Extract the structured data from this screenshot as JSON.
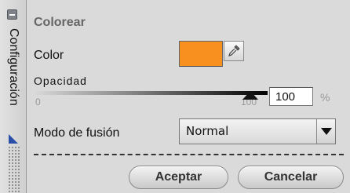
{
  "sidebar": {
    "tab_label": "Configuración"
  },
  "panel": {
    "title": "Colorear",
    "color_label": "Color",
    "color_value": "#f7901e",
    "opacity_label": "Opacidad",
    "opacity_min": "0",
    "opacity_max": "100",
    "opacity_value": "100",
    "opacity_unit": "%",
    "blend_label": "Modo de fusión",
    "blend_value": "Normal"
  },
  "buttons": {
    "accept": "Aceptar",
    "cancel": "Cancelar"
  },
  "icons": [
    "collapse-icon",
    "eyedropper-icon",
    "resize-corner-icon",
    "dropdown-arrow-icon",
    "slider-thumb-icon"
  ]
}
